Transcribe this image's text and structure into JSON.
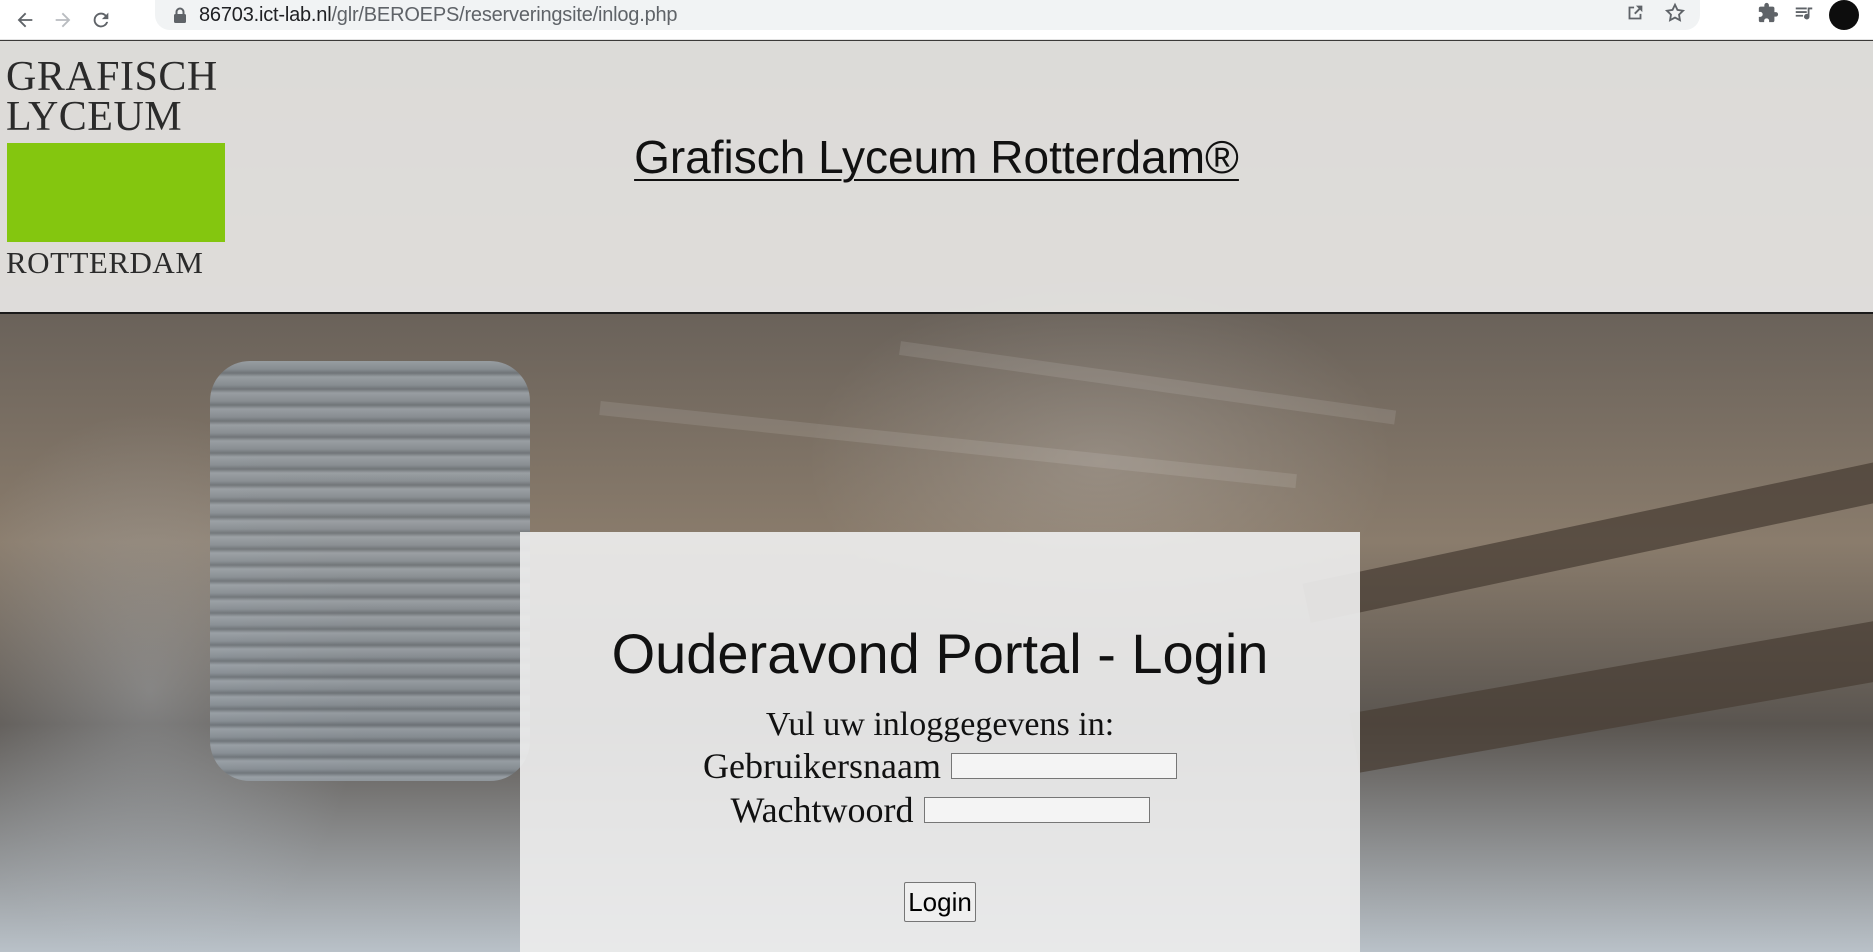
{
  "browser": {
    "url_host": "86703.ict-lab.nl",
    "url_path": "/glr/BEROEPS/reserveringsite/inlog.php",
    "icons": [
      "back-icon",
      "forward-icon",
      "reload-icon",
      "lock-icon",
      "share-icon",
      "star-icon",
      "extensions-icon",
      "media-icon",
      "avatar"
    ]
  },
  "header": {
    "logo": {
      "line1": "GRAFISCH",
      "line2": "LYCEUM",
      "line3": "ROTTERDAM",
      "green": "#84c60f"
    },
    "site_title": "Grafisch Lyceum Rotterdam®"
  },
  "login": {
    "title": "Ouderavond Portal - Login",
    "subtitle": "Vul uw inloggegevens in:",
    "username_label": "Gebruikersnaam",
    "username_value": "",
    "password_label": "Wachtwoord",
    "password_value": "",
    "button_label": "Login"
  }
}
